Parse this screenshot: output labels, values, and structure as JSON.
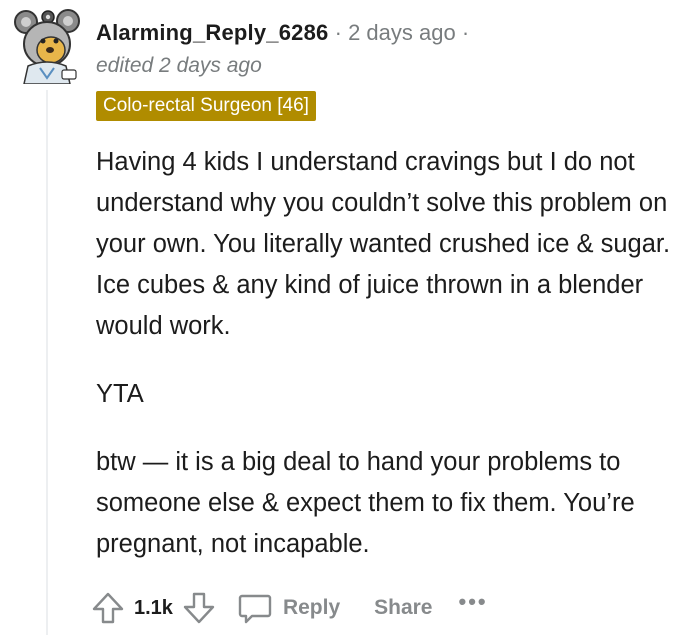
{
  "comment": {
    "author": "Alarming_Reply_6286",
    "separator": "·",
    "timestamp": "2 days ago",
    "edited": "edited 2 days ago",
    "flair": "Colo-rectal Surgeon [46]",
    "flair_color": "#b08c00",
    "paragraphs": [
      "Having 4 kids I understand cravings but I do not understand why you couldn’t solve this problem on your own. You literally wanted crushed ice & sugar. Ice cubes & any kind of juice thrown in a blender would work.",
      "YTA",
      "btw — it is a big deal to hand your problems to someone else & expect them to fix them. You’re pregnant, not incapable."
    ]
  },
  "actions": {
    "upvote_icon": "arrow-up-icon",
    "vote_count": "1.1k",
    "downvote_icon": "arrow-down-icon",
    "reply_icon": "speech-bubble-icon",
    "reply_label": "Reply",
    "share_label": "Share",
    "more_label": "•••"
  }
}
